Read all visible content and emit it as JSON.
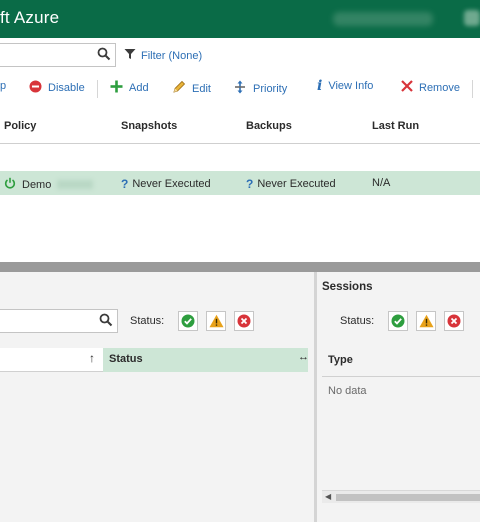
{
  "window": {
    "title": "ft Azure"
  },
  "top_search": {
    "value": ""
  },
  "filter": {
    "label": "Filter (None)"
  },
  "toolbar": {
    "start_label": "p",
    "disable_label": "Disable",
    "add_label": "Add",
    "edit_label": "Edit",
    "priority_label": "Priority",
    "view_info_label": "View Info",
    "remove_label": "Remove"
  },
  "policies_table": {
    "headers": [
      "Policy",
      "Snapshots",
      "Backups",
      "Last Run"
    ],
    "rows": [
      {
        "policy": "Demo",
        "snapshots": "Never Executed",
        "backups": "Never Executed",
        "last_run": "N/A"
      }
    ]
  },
  "lower_left": {
    "search_value": "",
    "status_label": "Status:",
    "sort_arrow": "↑",
    "status_column": "Status"
  },
  "sessions": {
    "title": "Sessions",
    "status_label": "Status:",
    "type_column": "Type",
    "empty_text": "No data"
  },
  "colors": {
    "title_bar": "#0a6b47",
    "selected_row": "#cde6d6",
    "link_blue": "#2d6fb5",
    "success": "#2e9e3f",
    "warning": "#e8a21b",
    "error": "#d8343a"
  }
}
